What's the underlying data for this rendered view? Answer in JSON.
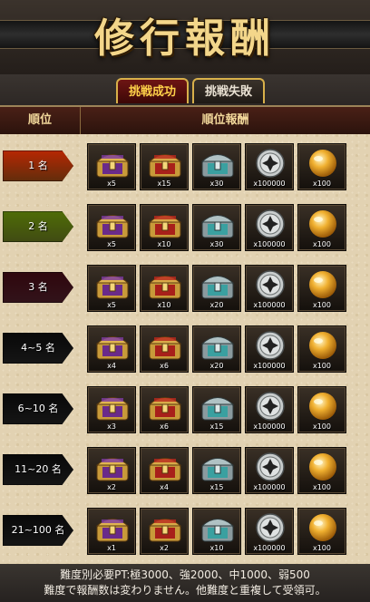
{
  "header": {
    "title": "修行報酬"
  },
  "tabs": [
    {
      "label": "挑戦成功",
      "active": true
    },
    {
      "label": "挑戦失敗",
      "active": false
    }
  ],
  "table": {
    "col_rank": "順位",
    "col_reward": "順位報酬",
    "rows": [
      {
        "rank": "1 名",
        "badge_color": "#d8641a",
        "qty": [
          "x5",
          "x15",
          "x30",
          "x100000",
          "x100"
        ]
      },
      {
        "rank": "2 名",
        "badge_color": "#8ea62a",
        "qty": [
          "x5",
          "x10",
          "x30",
          "x100000",
          "x100"
        ]
      },
      {
        "rank": "3 名",
        "badge_color": "#6e2a3a",
        "qty": [
          "x5",
          "x10",
          "x20",
          "x100000",
          "x100"
        ]
      },
      {
        "rank": "4~5 名",
        "badge_color": "#2f2f2f",
        "qty": [
          "x4",
          "x6",
          "x20",
          "x100000",
          "x100"
        ]
      },
      {
        "rank": "6~10 名",
        "badge_color": "#2f2f2f",
        "qty": [
          "x3",
          "x6",
          "x15",
          "x100000",
          "x100"
        ]
      },
      {
        "rank": "11~20 名",
        "badge_color": "#2f2f2f",
        "qty": [
          "x2",
          "x4",
          "x15",
          "x100000",
          "x100"
        ]
      },
      {
        "rank": "21~100 名",
        "badge_color": "#2f2f2f",
        "qty": [
          "x1",
          "x2",
          "x10",
          "x100000",
          "x100"
        ]
      }
    ],
    "item_icons": [
      "purple-treasure-chest-icon",
      "red-treasure-chest-icon",
      "silver-chest-icon",
      "silver-coin-icon",
      "gold-orb-icon"
    ]
  },
  "footer": {
    "line1": "難度別必要PT:極3000、強2000、中1000、弱500",
    "line2": "難度で報酬数は変わりません。他難度と重複して受領可。"
  },
  "colors": {
    "accent_gold": "#f3d68a",
    "tab_active_bg": "#6e1513"
  }
}
